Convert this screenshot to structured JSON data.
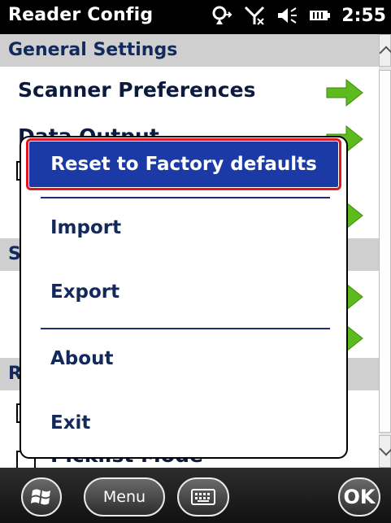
{
  "status_bar": {
    "app_title": "Reader Config",
    "time": "2:55",
    "icons": [
      "sync-icon",
      "no-signal-icon",
      "speaker-icon",
      "battery-icon"
    ]
  },
  "list": {
    "general_header": "General Settings",
    "scanner_preferences": "Scanner Preferences",
    "data_output": "Data Output",
    "second_header": "S",
    "third_header": "R",
    "picklist_mode": "Picklist Mode"
  },
  "menu": {
    "reset": "Reset to Factory defaults",
    "import": "Import",
    "export": "Export",
    "about": "About",
    "exit": "Exit"
  },
  "bottom_bar": {
    "menu_label": "Menu",
    "ok_label": "OK"
  },
  "colors": {
    "header_bg": "#cfcfcf",
    "menu_text": "#12295c",
    "selected_bg": "#1c3aa6",
    "selected_outline": "#e0151d",
    "arrow_green": "#5dbb1e"
  }
}
